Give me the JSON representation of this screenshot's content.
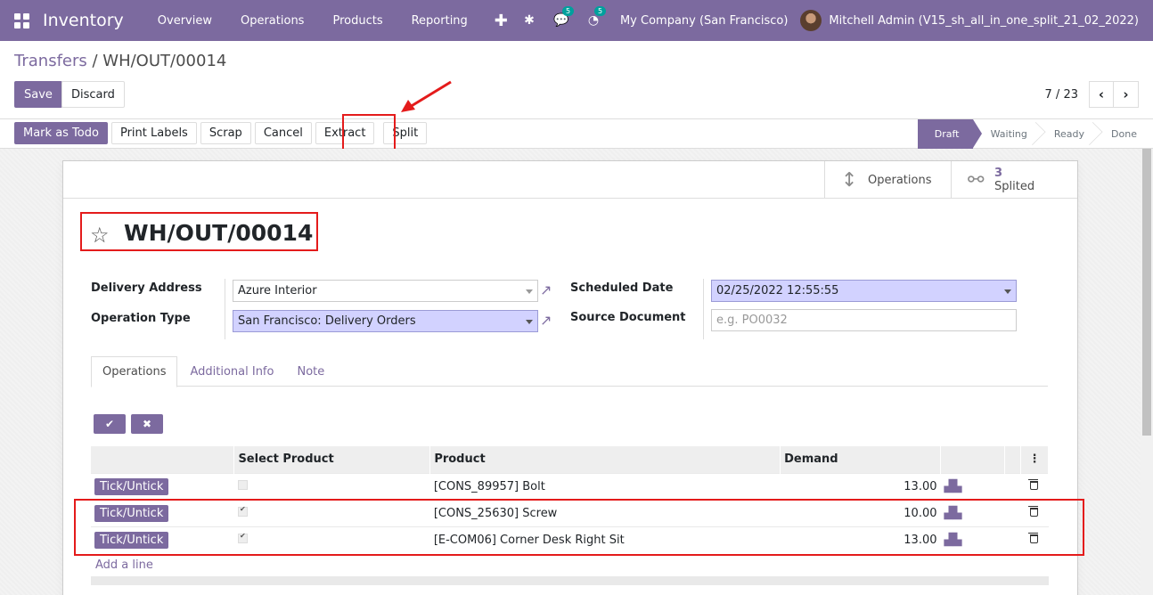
{
  "navbar": {
    "app_name": "Inventory",
    "menu": [
      "Overview",
      "Operations",
      "Products",
      "Reporting"
    ],
    "plus": "✚",
    "chat_badge": "5",
    "activity_badge": "5",
    "company": "My Company (San Francisco)",
    "user": "Mitchell Admin (V15_sh_all_in_one_split_21_02_2022)"
  },
  "breadcrumb": {
    "parent": "Transfers",
    "separator": " / ",
    "current": "WH/OUT/00014"
  },
  "control": {
    "save_label": "Save",
    "discard_label": "Discard",
    "pager_value": "7 / 23"
  },
  "header_buttons": {
    "mark_todo": "Mark as Todo",
    "print_labels": "Print Labels",
    "scrap": "Scrap",
    "cancel": "Cancel",
    "extract": "Extract",
    "split": "Split"
  },
  "stages": [
    "Draft",
    "Waiting",
    "Ready",
    "Done"
  ],
  "smart_buttons": {
    "operations_label": "Operations",
    "split_count": "3",
    "split_label": "Splited"
  },
  "record": {
    "title": "WH/OUT/00014",
    "delivery_address_label": "Delivery Address",
    "delivery_address": "Azure Interior",
    "operation_type_label": "Operation Type",
    "operation_type": "San Francisco: Delivery Orders",
    "scheduled_date_label": "Scheduled Date",
    "scheduled_date": "02/25/2022 12:55:55",
    "source_document_label": "Source Document",
    "source_document_placeholder": "e.g. PO0032"
  },
  "tabs": [
    "Operations",
    "Additional Info",
    "Note"
  ],
  "table": {
    "headers": {
      "select": "Select Product",
      "product": "Product",
      "demand": "Demand"
    },
    "rows": [
      {
        "tick": "Tick/Untick",
        "selected": false,
        "product": "[CONS_89957] Bolt",
        "demand": "13.00"
      },
      {
        "tick": "Tick/Untick",
        "selected": true,
        "product": "[CONS_25630] Screw",
        "demand": "10.00"
      },
      {
        "tick": "Tick/Untick",
        "selected": true,
        "product": "[E-COM06] Corner Desk Right Sit",
        "demand": "13.00"
      }
    ],
    "add_line": "Add a line"
  },
  "colors": {
    "brand": "#7c6a9f",
    "annotation": "#e41b1b",
    "required_field": "#d2d2ff"
  }
}
